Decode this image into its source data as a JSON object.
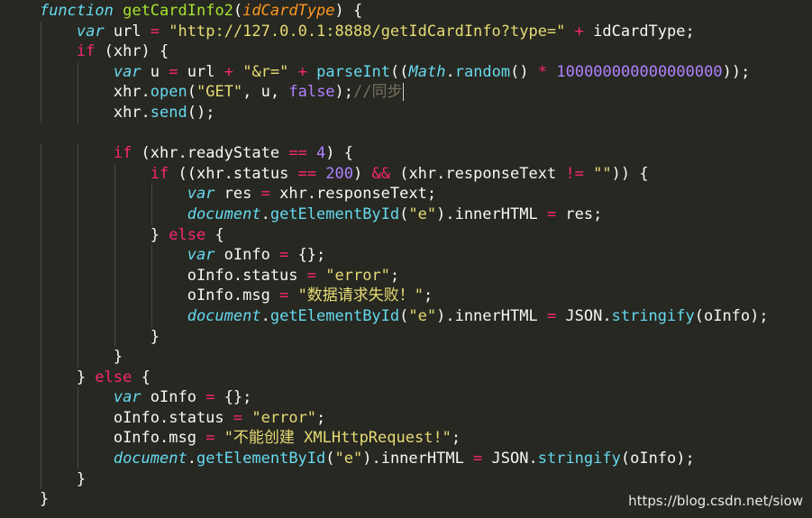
{
  "editor": {
    "theme": "monokai",
    "colors": {
      "background": "#272822",
      "keyword": "#f92672",
      "storage": "#66d9ef",
      "function": "#a6e22e",
      "parameter": "#fd971f",
      "string": "#e6db74",
      "number": "#ae81ff",
      "comment": "#75715e",
      "text": "#f8f8f2"
    },
    "lines": [
      {
        "indent": 1,
        "tokens": [
          [
            "store",
            "function"
          ],
          [
            "t",
            " "
          ],
          [
            "fn",
            "getCardInfo2"
          ],
          [
            "t",
            "("
          ],
          [
            "param",
            "idCardType"
          ],
          [
            "t",
            ") {"
          ]
        ]
      },
      {
        "indent": 2,
        "tokens": [
          [
            "store",
            "var"
          ],
          [
            "t",
            " url "
          ],
          [
            "kw",
            "="
          ],
          [
            "t",
            " "
          ],
          [
            "str",
            "\"http://127.0.0.1:8888/getIdCardInfo?type=\""
          ],
          [
            "t",
            " "
          ],
          [
            "kw",
            "+"
          ],
          [
            "t",
            " idCardType;"
          ]
        ]
      },
      {
        "indent": 2,
        "tokens": [
          [
            "kw",
            "if"
          ],
          [
            "t",
            " (xhr) {"
          ]
        ]
      },
      {
        "indent": 3,
        "tokens": [
          [
            "store",
            "var"
          ],
          [
            "t",
            " u "
          ],
          [
            "kw",
            "="
          ],
          [
            "t",
            " url "
          ],
          [
            "kw",
            "+"
          ],
          [
            "t",
            " "
          ],
          [
            "str",
            "\"&r=\""
          ],
          [
            "t",
            " "
          ],
          [
            "kw",
            "+"
          ],
          [
            "t",
            " "
          ],
          [
            "sup",
            "parseInt"
          ],
          [
            "t",
            "(("
          ],
          [
            "cls",
            "Math"
          ],
          [
            "t",
            "."
          ],
          [
            "sup",
            "random"
          ],
          [
            "t",
            "() "
          ],
          [
            "kw",
            "*"
          ],
          [
            "t",
            " "
          ],
          [
            "num",
            "100000000000000000"
          ],
          [
            "t",
            "));"
          ]
        ]
      },
      {
        "indent": 3,
        "tokens": [
          [
            "t",
            "xhr."
          ],
          [
            "sup",
            "open"
          ],
          [
            "t",
            "("
          ],
          [
            "str",
            "\"GET\""
          ],
          [
            "t",
            ", u, "
          ],
          [
            "lit",
            "false"
          ],
          [
            "t",
            ");"
          ],
          [
            "cmt",
            "//同步"
          ],
          [
            "cursor",
            ""
          ]
        ]
      },
      {
        "indent": 3,
        "tokens": [
          [
            "t",
            "xhr."
          ],
          [
            "sup",
            "send"
          ],
          [
            "t",
            "();"
          ]
        ]
      },
      {
        "indent": 0,
        "tokens": []
      },
      {
        "indent": 3,
        "tokens": [
          [
            "kw",
            "if"
          ],
          [
            "t",
            " (xhr.readyState "
          ],
          [
            "kw",
            "=="
          ],
          [
            "t",
            " "
          ],
          [
            "num",
            "4"
          ],
          [
            "t",
            ") {"
          ]
        ]
      },
      {
        "indent": 4,
        "tokens": [
          [
            "kw",
            "if"
          ],
          [
            "t",
            " ((xhr.status "
          ],
          [
            "kw",
            "=="
          ],
          [
            "t",
            " "
          ],
          [
            "num",
            "200"
          ],
          [
            "t",
            ") "
          ],
          [
            "kw",
            "&&"
          ],
          [
            "t",
            " (xhr.responseText "
          ],
          [
            "kw",
            "!="
          ],
          [
            "t",
            " "
          ],
          [
            "str",
            "\"\""
          ],
          [
            "t",
            ")) {"
          ]
        ]
      },
      {
        "indent": 5,
        "tokens": [
          [
            "store",
            "var"
          ],
          [
            "t",
            " res "
          ],
          [
            "kw",
            "="
          ],
          [
            "t",
            " xhr.responseText;"
          ]
        ]
      },
      {
        "indent": 5,
        "tokens": [
          [
            "cls",
            "document"
          ],
          [
            "t",
            "."
          ],
          [
            "sup",
            "getElementById"
          ],
          [
            "t",
            "("
          ],
          [
            "str",
            "\"e\""
          ],
          [
            "t",
            ").innerHTML "
          ],
          [
            "kw",
            "="
          ],
          [
            "t",
            " res;"
          ]
        ]
      },
      {
        "indent": 4,
        "tokens": [
          [
            "t",
            "} "
          ],
          [
            "kw",
            "else"
          ],
          [
            "t",
            " {"
          ]
        ]
      },
      {
        "indent": 5,
        "tokens": [
          [
            "store",
            "var"
          ],
          [
            "t",
            " oInfo "
          ],
          [
            "kw",
            "="
          ],
          [
            "t",
            " {};"
          ]
        ]
      },
      {
        "indent": 5,
        "tokens": [
          [
            "t",
            "oInfo.status "
          ],
          [
            "kw",
            "="
          ],
          [
            "t",
            " "
          ],
          [
            "str",
            "\"error\""
          ],
          [
            "t",
            ";"
          ]
        ]
      },
      {
        "indent": 5,
        "tokens": [
          [
            "t",
            "oInfo.msg "
          ],
          [
            "kw",
            "="
          ],
          [
            "t",
            " "
          ],
          [
            "str",
            "\"数据请求失败！\""
          ],
          [
            "t",
            ";"
          ]
        ]
      },
      {
        "indent": 5,
        "tokens": [
          [
            "cls",
            "document"
          ],
          [
            "t",
            "."
          ],
          [
            "sup",
            "getElementById"
          ],
          [
            "t",
            "("
          ],
          [
            "str",
            "\"e\""
          ],
          [
            "t",
            ").innerHTML "
          ],
          [
            "kw",
            "="
          ],
          [
            "t",
            " JSON."
          ],
          [
            "sup",
            "stringify"
          ],
          [
            "t",
            "(oInfo);"
          ]
        ]
      },
      {
        "indent": 4,
        "tokens": [
          [
            "t",
            "}"
          ]
        ]
      },
      {
        "indent": 3,
        "tokens": [
          [
            "t",
            "}"
          ]
        ]
      },
      {
        "indent": 2,
        "tokens": [
          [
            "t",
            "} "
          ],
          [
            "kw",
            "else"
          ],
          [
            "t",
            " {"
          ]
        ]
      },
      {
        "indent": 3,
        "tokens": [
          [
            "store",
            "var"
          ],
          [
            "t",
            " oInfo "
          ],
          [
            "kw",
            "="
          ],
          [
            "t",
            " {};"
          ]
        ]
      },
      {
        "indent": 3,
        "tokens": [
          [
            "t",
            "oInfo.status "
          ],
          [
            "kw",
            "="
          ],
          [
            "t",
            " "
          ],
          [
            "str",
            "\"error\""
          ],
          [
            "t",
            ";"
          ]
        ]
      },
      {
        "indent": 3,
        "tokens": [
          [
            "t",
            "oInfo.msg "
          ],
          [
            "kw",
            "="
          ],
          [
            "t",
            " "
          ],
          [
            "str",
            "\"不能创建 XMLHttpRequest!\""
          ],
          [
            "t",
            ";"
          ]
        ]
      },
      {
        "indent": 3,
        "tokens": [
          [
            "cls",
            "document"
          ],
          [
            "t",
            "."
          ],
          [
            "sup",
            "getElementById"
          ],
          [
            "t",
            "("
          ],
          [
            "str",
            "\"e\""
          ],
          [
            "t",
            ").innerHTML "
          ],
          [
            "kw",
            "="
          ],
          [
            "t",
            " JSON."
          ],
          [
            "sup",
            "stringify"
          ],
          [
            "t",
            "(oInfo);"
          ]
        ]
      },
      {
        "indent": 2,
        "tokens": [
          [
            "t",
            "}"
          ]
        ]
      },
      {
        "indent": 1,
        "tokens": [
          [
            "t",
            "}"
          ]
        ]
      }
    ]
  },
  "watermark": "https://blog.csdn.net/siow"
}
